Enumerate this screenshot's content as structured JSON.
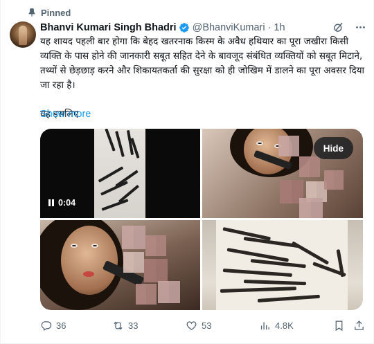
{
  "pinned_label": "Pinned",
  "author": {
    "name": "Bhanvi Kumari Singh Bhadri",
    "handle": "@BhanviKumari",
    "separator": "·",
    "time": "1h"
  },
  "body": {
    "paragraph1": "यह शायद पहली बार होगा कि बेहद खतरनाक किस्म के अवैध हथियार का पूरा जखीरा किसी व्यक्ति के पास होने की जानकारी सबूत सहित देने के बावजूद संबंधित व्यक्तियों को सबूत मिटाने, तथ्यों से छेड़छाड़ करने और शिकायतकर्ता की सुरक्षा को ही जोखिम में डालने का पूरा अवसर दिया जा रहा है।",
    "paragraph2": "यह इसलिए",
    "show_more": "Show more"
  },
  "media": {
    "video_duration": "0:04",
    "hide_label": "Hide"
  },
  "actions": {
    "replies": "36",
    "reposts": "33",
    "likes": "53",
    "views": "4.8K"
  },
  "colors": {
    "accent": "#1d9bf0",
    "secondary_text": "#536471",
    "primary_text": "#0f1419"
  }
}
